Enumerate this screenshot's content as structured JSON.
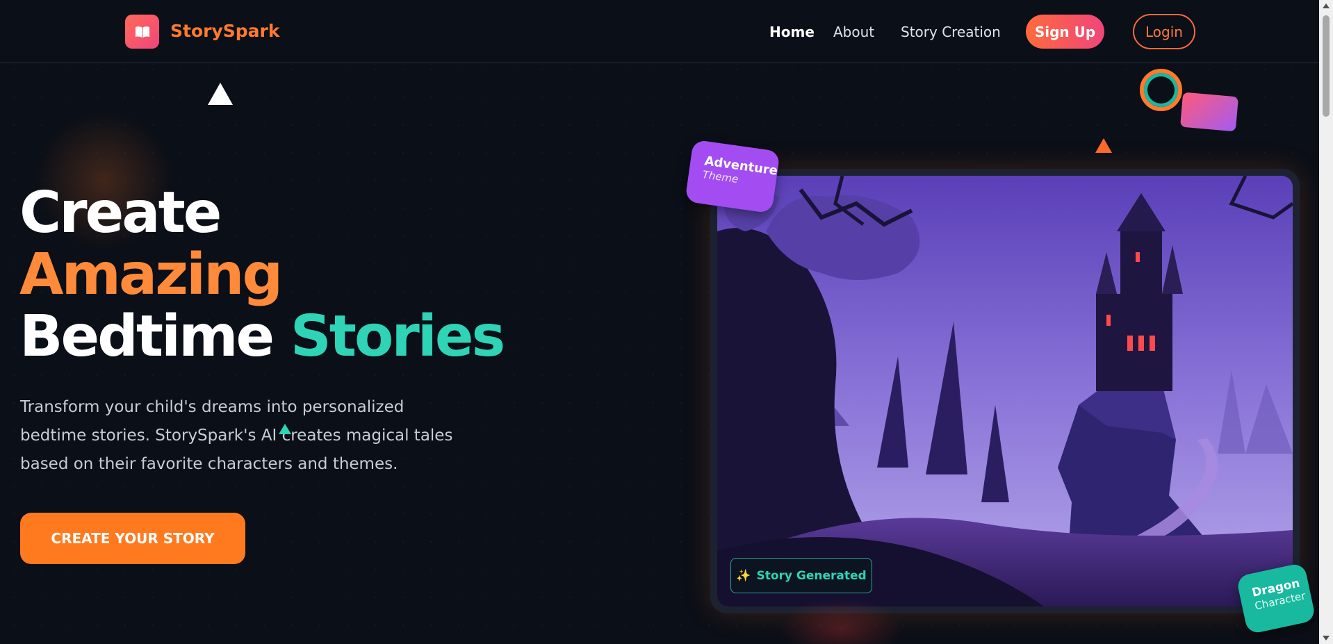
{
  "brand": {
    "name": "StorySpark",
    "logo_icon": "book-icon"
  },
  "nav": {
    "items": [
      {
        "label": "Home",
        "active": true
      },
      {
        "label": "About",
        "active": false
      },
      {
        "label": "Story Creation",
        "active": false
      }
    ],
    "signup_label": "Sign Up",
    "login_label": "Login"
  },
  "hero": {
    "title_line1": "Create",
    "title_line2": "Amazing",
    "title_line3_a": "Bedtime",
    "title_line3_b": "Stories",
    "description": "Transform your child's dreams into personalized bedtime stories. StorySpark's AI creates magical tales based on their favorite characters and themes.",
    "cta_label": "CREATE YOUR STORY"
  },
  "card": {
    "image_icon": "haunted-castle-illustration",
    "badge_story": "Story Generated",
    "badge_story_icon": "sparkles-icon",
    "badge_theme_title": "Adventure",
    "badge_theme_sub": "Theme",
    "badge_character_title": "Dragon",
    "badge_character_sub": "Character"
  },
  "colors": {
    "background": "#0b0f17",
    "accent_orange": "#ff7a1f",
    "accent_teal": "#2fd3b5",
    "accent_pink": "#f0457a",
    "accent_purple": "#a24cf2"
  }
}
